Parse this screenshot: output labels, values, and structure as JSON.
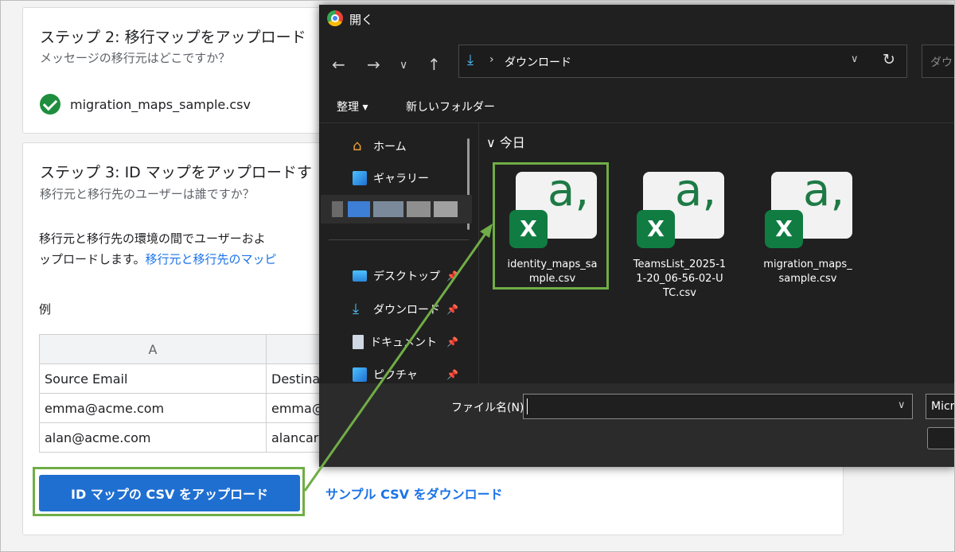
{
  "step2": {
    "title": "ステップ 2: 移行マップをアップロード",
    "subtitle": "メッセージの移行元はどこですか？",
    "uploaded_file": "migration_maps_sample.csv"
  },
  "step3": {
    "title": "ステップ 3: ID マップをアップロードす",
    "subtitle": "移行元と移行先のユーザーは誰ですか？",
    "desc_line1": "移行元と移行先の環境の間でユーザーおよ",
    "desc_line2_text": "ップロードします。",
    "desc_line2_link": "移行元と移行先のマッピ",
    "example_label": "例",
    "table": {
      "headers": [
        "A",
        ""
      ],
      "rows": [
        [
          "Source Email",
          "Destina"
        ],
        [
          "emma@acme.com",
          "emma@"
        ],
        [
          "alan@acme.com",
          "alancar"
        ]
      ]
    },
    "upload_button": "ID マップの CSV をアップロード",
    "sample_link": "サンプル CSV をダウンロード"
  },
  "dialog": {
    "title": "開く",
    "address": {
      "path": "ダウンロード",
      "search_placeholder": "ダウン"
    },
    "toolbar": {
      "organize": "整理 ▾",
      "new_folder": "新しいフォルダー"
    },
    "sidebar": [
      {
        "label": "ホーム",
        "icon": "home-icon",
        "pinned": false
      },
      {
        "label": "ギャラリー",
        "icon": "gallery-icon",
        "pinned": false
      },
      {
        "label": "デスクトップ",
        "icon": "desktop-icon",
        "pinned": true
      },
      {
        "label": "ダウンロード",
        "icon": "download-icon",
        "pinned": true
      },
      {
        "label": "ドキュメント",
        "icon": "document-icon",
        "pinned": true
      },
      {
        "label": "ピクチャ",
        "icon": "pictures-icon",
        "pinned": true
      }
    ],
    "group_header": "今日",
    "files": [
      {
        "line1": "identity_maps_sa",
        "line2": "mple.csv",
        "line3": "",
        "selected": true
      },
      {
        "line1": "TeamsList_2025-1",
        "line2": "1-20_06-56-02-U",
        "line3": "TC.csv",
        "selected": false
      },
      {
        "line1": "migration_maps_",
        "line2": "sample.csv",
        "line3": "",
        "selected": false
      }
    ],
    "filename_label": "ファイル名(N):",
    "filename_value": "",
    "filetype_value": "Micr"
  },
  "colors": {
    "highlight": "#70ad47",
    "primary_button": "#1f6fd1",
    "link": "#1a73e8",
    "dialog_bg": "#202020",
    "excel_green": "#107c41"
  }
}
